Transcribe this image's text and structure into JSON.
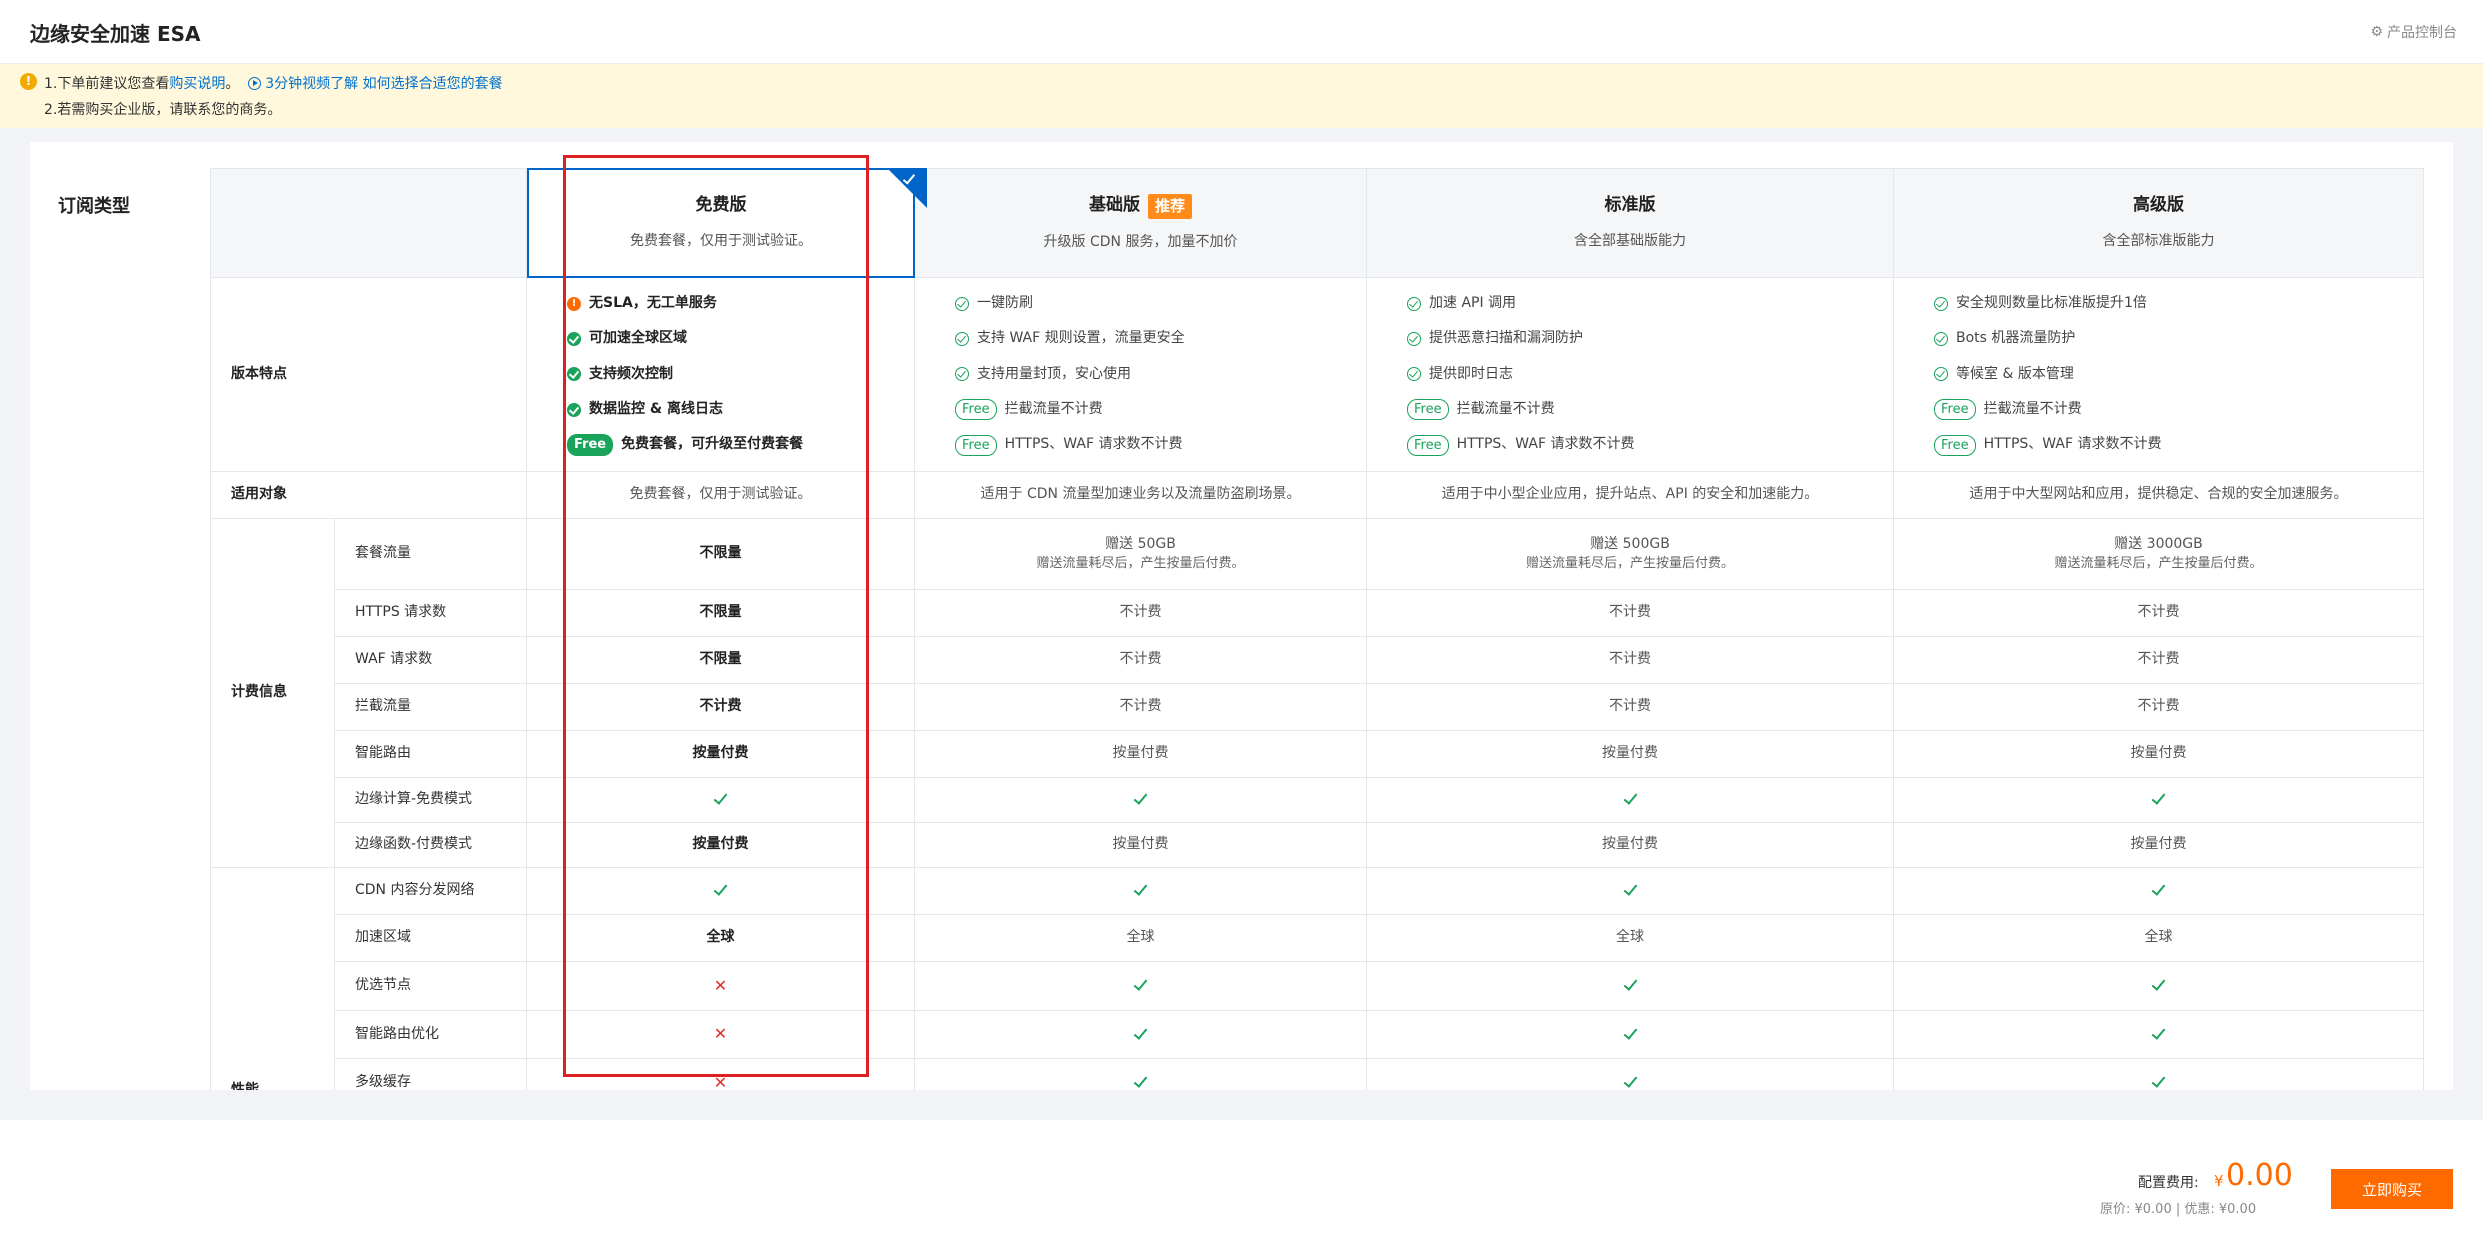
{
  "header": {
    "title": "边缘安全加速 ESA",
    "console_link": "产品控制台"
  },
  "notice": {
    "line1_prefix": "1.下单前建议您查看",
    "line1_link": "购买说明",
    "line1_sep": "。",
    "line1_video": "3分钟视频了解 如何选择合适您的套餐",
    "line2": "2.若需购买企业版，请联系您的商务。"
  },
  "section_label": "订阅类型",
  "plans": [
    {
      "name": "免费版",
      "desc": "免费套餐，仅用于测试验证。",
      "badge": ""
    },
    {
      "name": "基础版",
      "desc": "升级版 CDN 服务，加量不加价",
      "badge": "推荐"
    },
    {
      "name": "标准版",
      "desc": "含全部基础版能力",
      "badge": ""
    },
    {
      "name": "高级版",
      "desc": "含全部标准版能力",
      "badge": ""
    }
  ],
  "rows": {
    "features_label": "版本特点",
    "audience_label": "适用对象",
    "billing_label": "计费信息",
    "perf_label": "性能",
    "billing_rows": [
      "套餐流量",
      "HTTPS 请求数",
      "WAF 请求数",
      "拦截流量",
      "智能路由",
      "边缘计算-免费模式",
      "边缘函数-付费模式"
    ],
    "perf_rows": [
      "CDN 内容分发网络",
      "加速区域",
      "优选节点",
      "智能路由优化",
      "多级缓存"
    ]
  },
  "features": [
    [
      {
        "icon": "warn",
        "text": "无SLA，无工单服务"
      },
      {
        "icon": "okf",
        "text": "可加速全球区域"
      },
      {
        "icon": "okf",
        "text": "支持频次控制"
      },
      {
        "icon": "okf",
        "text": "数据监控 & 离线日志"
      },
      {
        "icon": "free-filled",
        "badge": "Free",
        "text": "免费套餐，可升级至付费套餐"
      }
    ],
    [
      {
        "icon": "ok",
        "text": "一键防刷"
      },
      {
        "icon": "ok",
        "text": "支持 WAF 规则设置，流量更安全"
      },
      {
        "icon": "ok",
        "text": "支持用量封顶，安心使用"
      },
      {
        "icon": "free",
        "badge": "Free",
        "text": "拦截流量不计费"
      },
      {
        "icon": "free",
        "badge": "Free",
        "text": "HTTPS、WAF 请求数不计费"
      }
    ],
    [
      {
        "icon": "ok",
        "text": "加速 API 调用"
      },
      {
        "icon": "ok",
        "text": "提供恶意扫描和漏洞防护"
      },
      {
        "icon": "ok",
        "text": "提供即时日志"
      },
      {
        "icon": "free",
        "badge": "Free",
        "text": "拦截流量不计费"
      },
      {
        "icon": "free",
        "badge": "Free",
        "text": "HTTPS、WAF 请求数不计费"
      }
    ],
    [
      {
        "icon": "ok",
        "text": "安全规则数量比标准版提升1倍"
      },
      {
        "icon": "ok",
        "text": "Bots 机器流量防护"
      },
      {
        "icon": "ok",
        "text": "等候室 & 版本管理"
      },
      {
        "icon": "free",
        "badge": "Free",
        "text": "拦截流量不计费"
      },
      {
        "icon": "free",
        "badge": "Free",
        "text": "HTTPS、WAF 请求数不计费"
      }
    ]
  ],
  "audience": [
    "免费套餐，仅用于测试验证。",
    "适用于 CDN 流量型加速业务以及流量防盗刷场景。",
    "适用于中小型企业应用，提升站点、API 的安全和加速能力。",
    "适用于中大型网站和应用，提供稳定、合规的安全加速服务。"
  ],
  "traffic": [
    {
      "main": "不限量",
      "sub": ""
    },
    {
      "main": "赠送 50GB",
      "sub": "赠送流量耗尽后，产生按量后付费。"
    },
    {
      "main": "赠送 500GB",
      "sub": "赠送流量耗尽后，产生按量后付费。"
    },
    {
      "main": "赠送 3000GB",
      "sub": "赠送流量耗尽后，产生按量后付费。"
    }
  ],
  "billing_values": [
    [
      "不限量",
      "不计费",
      "不计费",
      "不计费"
    ],
    [
      "不限量",
      "不计费",
      "不计费",
      "不计费"
    ],
    [
      "不计费",
      "不计费",
      "不计费",
      "不计费"
    ],
    [
      "按量付费",
      "按量付费",
      "按量付费",
      "按量付费"
    ],
    [
      "check",
      "check",
      "check",
      "check"
    ],
    [
      "按量付费",
      "按量付费",
      "按量付费",
      "按量付费"
    ]
  ],
  "perf_values": [
    [
      "check",
      "check",
      "check",
      "check"
    ],
    [
      "全球",
      "全球",
      "全球",
      "全球"
    ],
    [
      "cross",
      "check",
      "check",
      "check"
    ],
    [
      "cross",
      "check",
      "check",
      "check"
    ],
    [
      "cross",
      "check",
      "check",
      "check"
    ]
  ],
  "footer": {
    "fee_label": "配置费用:",
    "currency": "¥",
    "fee": "0.00",
    "orig": "原价: ¥0.00 | 优惠: ¥0.00",
    "buy": "立即购买"
  },
  "colors": {
    "accent": "#ff6a00",
    "check": "#19a35b",
    "cross": "#e0302c",
    "link": "#0070cc",
    "highlight_box": "#e02020"
  }
}
